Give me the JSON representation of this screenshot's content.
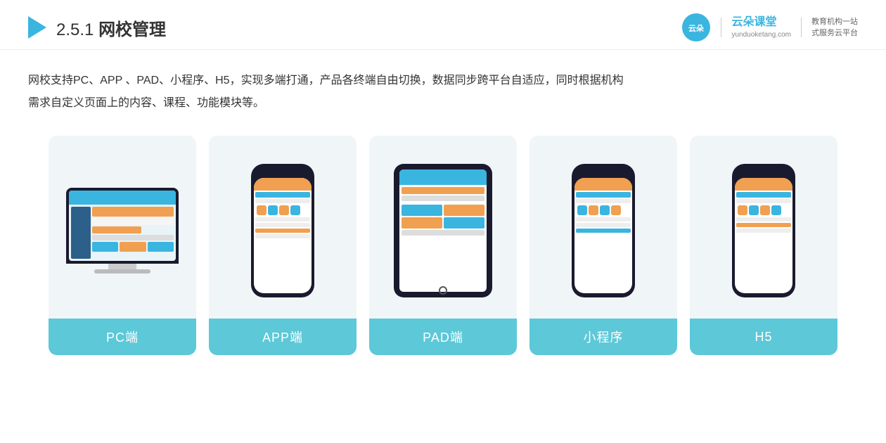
{
  "header": {
    "section_number": "2.5.1",
    "title_plain": " ",
    "title_bold": "网校管理",
    "logo": {
      "icon_text": "云朵",
      "main_name": "云朵课堂",
      "url": "yunduoketang.com",
      "tagline_line1": "教育机构一站",
      "tagline_line2": "式服务云平台"
    }
  },
  "description": {
    "text": "网校支持PC、APP、PAD、小程序、H5，实现多端打通，产品各终端自由切换，数据同步跨平台自适应，同时根据机构需求自定义页面上的内容、课程、功能模块等。"
  },
  "cards": [
    {
      "id": "pc",
      "label": "PC端"
    },
    {
      "id": "app",
      "label": "APP端"
    },
    {
      "id": "pad",
      "label": "PAD端"
    },
    {
      "id": "miniprogram",
      "label": "小程序"
    },
    {
      "id": "h5",
      "label": "H5"
    }
  ],
  "icons": {
    "arrow": "▶",
    "cloud": "☁"
  }
}
